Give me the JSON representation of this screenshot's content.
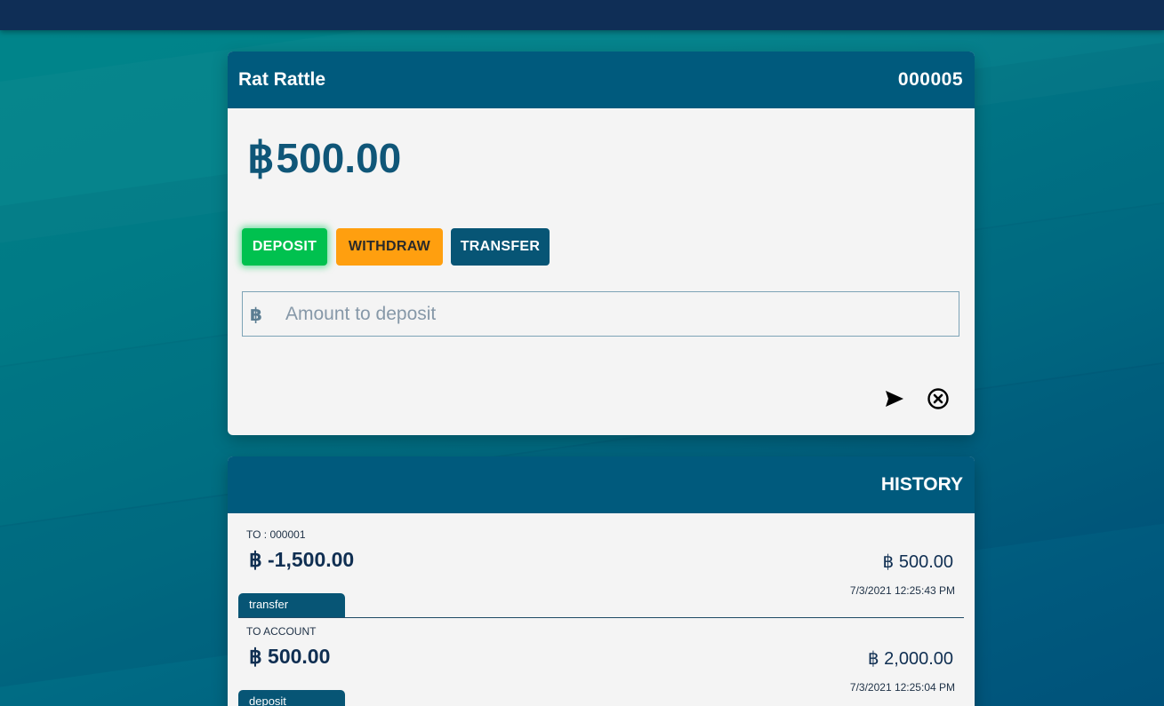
{
  "colors": {
    "topbar": "#0f2e56",
    "card_header": "#005a7d",
    "deposit": "#00c14f",
    "withdraw": "#ff9f0f",
    "transfer": "#075575",
    "balance_text": "#0f5678"
  },
  "account": {
    "name": "Rat Rattle",
    "number": "000005",
    "currency_symbol": "฿",
    "balance": "500.00"
  },
  "actions": {
    "deposit_label": "DEPOSIT",
    "withdraw_label": "WITHDRAW",
    "transfer_label": "TRANSFER",
    "active": "deposit"
  },
  "amount_input": {
    "icon": "฿",
    "placeholder": "Amount to deposit",
    "value": ""
  },
  "form_icons": {
    "submit": "send-icon",
    "cancel": "cancel-circle-icon"
  },
  "history": {
    "title": "HISTORY",
    "transactions": [
      {
        "label": "TO : 000001",
        "amount": "฿ -1,500.00",
        "balance": "฿ 500.00",
        "type": "transfer",
        "date": "7/3/2021 12:25:43 PM"
      },
      {
        "label": "TO ACCOUNT",
        "amount": "฿ 500.00",
        "balance": "฿ 2,000.00",
        "type": "deposit",
        "date": "7/3/2021 12:25:04 PM"
      }
    ]
  }
}
